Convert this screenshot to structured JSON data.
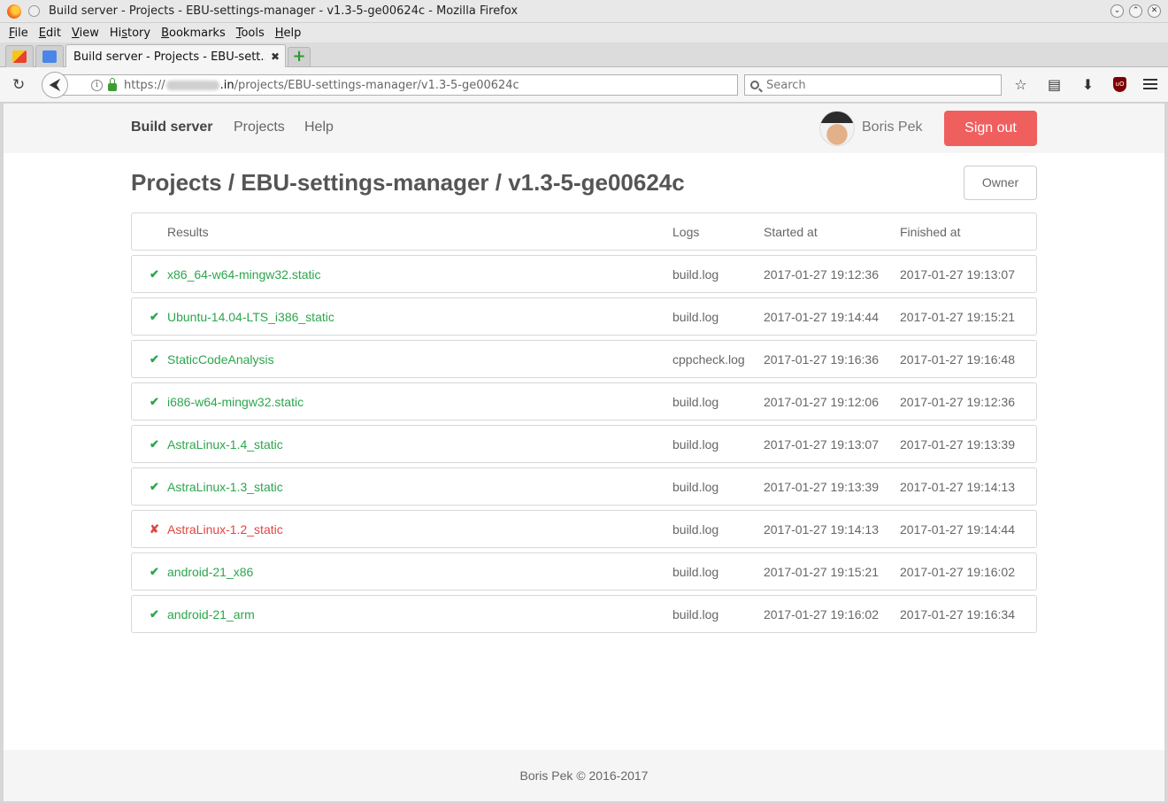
{
  "window": {
    "title": "Build server - Projects - EBU-settings-manager - v1.3-5-ge00624c - Mozilla Firefox"
  },
  "menubar": {
    "items": [
      {
        "accel": "F",
        "rest": "ile"
      },
      {
        "accel": "E",
        "rest": "dit"
      },
      {
        "accel": "V",
        "rest": "iew"
      },
      {
        "pre": "Hi",
        "accel": "s",
        "rest": "tory"
      },
      {
        "accel": "B",
        "rest": "ookmarks"
      },
      {
        "accel": "T",
        "rest": "ools"
      },
      {
        "accel": "H",
        "rest": "elp"
      }
    ]
  },
  "tabs": {
    "current_label": "Build server - Projects - EBU-sett...",
    "close_glyph": "✖",
    "new_tab_glyph": "+"
  },
  "navbar": {
    "url_prefix": "https://",
    "url_domain": ".in",
    "url_rest": "/projects/EBU-settings-manager/v1.3-5-ge00624c",
    "search_placeholder": "Search"
  },
  "site": {
    "brand": "Build server",
    "nav": [
      "Projects",
      "Help"
    ],
    "user_name": "Boris Pek",
    "signout_label": "Sign out"
  },
  "page": {
    "title": "Projects / EBU-settings-manager / v1.3-5-ge00624c",
    "owner_label": "Owner"
  },
  "table": {
    "headers": {
      "results": "Results",
      "logs": "Logs",
      "started": "Started at",
      "finished": "Finished at"
    },
    "rows": [
      {
        "status": "ok",
        "mark": "✔",
        "name": "x86_64-w64-mingw32.static",
        "log": "build.log",
        "started": "2017-01-27 19:12:36",
        "finished": "2017-01-27 19:13:07"
      },
      {
        "status": "ok",
        "mark": "✔",
        "name": "Ubuntu-14.04-LTS_i386_static",
        "log": "build.log",
        "started": "2017-01-27 19:14:44",
        "finished": "2017-01-27 19:15:21"
      },
      {
        "status": "ok",
        "mark": "✔",
        "name": "StaticCodeAnalysis",
        "log": "cppcheck.log",
        "started": "2017-01-27 19:16:36",
        "finished": "2017-01-27 19:16:48"
      },
      {
        "status": "ok",
        "mark": "✔",
        "name": "i686-w64-mingw32.static",
        "log": "build.log",
        "started": "2017-01-27 19:12:06",
        "finished": "2017-01-27 19:12:36"
      },
      {
        "status": "ok",
        "mark": "✔",
        "name": "AstraLinux-1.4_static",
        "log": "build.log",
        "started": "2017-01-27 19:13:07",
        "finished": "2017-01-27 19:13:39"
      },
      {
        "status": "ok",
        "mark": "✔",
        "name": "AstraLinux-1.3_static",
        "log": "build.log",
        "started": "2017-01-27 19:13:39",
        "finished": "2017-01-27 19:14:13"
      },
      {
        "status": "fail",
        "mark": "✘",
        "name": "AstraLinux-1.2_static",
        "log": "build.log",
        "started": "2017-01-27 19:14:13",
        "finished": "2017-01-27 19:14:44"
      },
      {
        "status": "ok",
        "mark": "✔",
        "name": "android-21_x86",
        "log": "build.log",
        "started": "2017-01-27 19:15:21",
        "finished": "2017-01-27 19:16:02"
      },
      {
        "status": "ok",
        "mark": "✔",
        "name": "android-21_arm",
        "log": "build.log",
        "started": "2017-01-27 19:16:02",
        "finished": "2017-01-27 19:16:34"
      }
    ]
  },
  "footer": {
    "text": "Boris Pek © 2016-2017"
  },
  "colors": {
    "success": "#2ca64d",
    "failure": "#e0463f",
    "signout": "#ef5f5e"
  }
}
